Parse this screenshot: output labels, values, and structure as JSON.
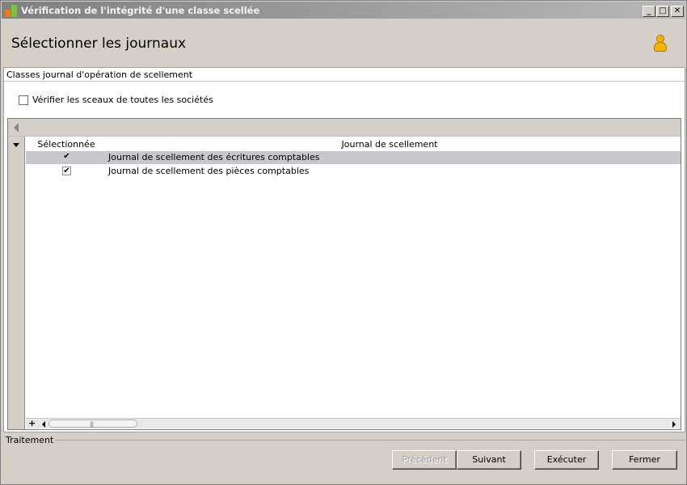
{
  "window": {
    "title": "Vérification de l'intégrité d'une classe scellée",
    "controls": {
      "minimize": "_",
      "maximize": "□",
      "close": "✕"
    }
  },
  "header": {
    "title": "Sélectionner les journaux",
    "icon": "user-icon"
  },
  "group": {
    "label": "Classes journal d'opération de scellement"
  },
  "options": {
    "check_all_label": "Vérifier les sceaux de toutes les sociétés",
    "check_all_checked": false
  },
  "grid": {
    "columns": [
      "Sélectionnée",
      "Journal de scellement"
    ],
    "rows": [
      {
        "selected": "✔",
        "journal": "Journal de scellement des écritures comptables"
      },
      {
        "selected": "✔",
        "journal": "Journal de scellement des pièces comptables"
      }
    ],
    "add_label": "+",
    "scroll_grip": "|||"
  },
  "footer": {
    "section_label": "Traitement",
    "buttons": {
      "previous": "Précédent",
      "next": "Suivant",
      "execute": "Exécuter",
      "close": "Fermer"
    }
  }
}
